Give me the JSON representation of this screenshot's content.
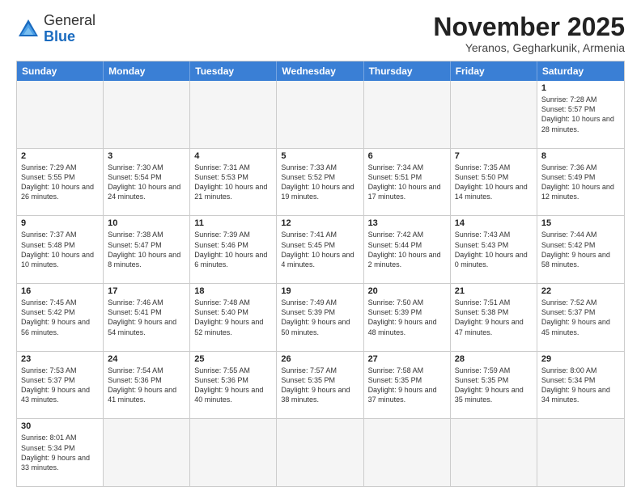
{
  "header": {
    "logo_general": "General",
    "logo_blue": "Blue",
    "month_title": "November 2025",
    "location": "Yeranos, Gegharkunik, Armenia"
  },
  "days_of_week": [
    "Sunday",
    "Monday",
    "Tuesday",
    "Wednesday",
    "Thursday",
    "Friday",
    "Saturday"
  ],
  "weeks": [
    [
      {
        "day": "",
        "info": "",
        "empty": true
      },
      {
        "day": "",
        "info": "",
        "empty": true
      },
      {
        "day": "",
        "info": "",
        "empty": true
      },
      {
        "day": "",
        "info": "",
        "empty": true
      },
      {
        "day": "",
        "info": "",
        "empty": true
      },
      {
        "day": "",
        "info": "",
        "empty": true
      },
      {
        "day": "1",
        "info": "Sunrise: 7:28 AM\nSunset: 5:57 PM\nDaylight: 10 hours and 28 minutes."
      }
    ],
    [
      {
        "day": "2",
        "info": "Sunrise: 7:29 AM\nSunset: 5:55 PM\nDaylight: 10 hours and 26 minutes."
      },
      {
        "day": "3",
        "info": "Sunrise: 7:30 AM\nSunset: 5:54 PM\nDaylight: 10 hours and 24 minutes."
      },
      {
        "day": "4",
        "info": "Sunrise: 7:31 AM\nSunset: 5:53 PM\nDaylight: 10 hours and 21 minutes."
      },
      {
        "day": "5",
        "info": "Sunrise: 7:33 AM\nSunset: 5:52 PM\nDaylight: 10 hours and 19 minutes."
      },
      {
        "day": "6",
        "info": "Sunrise: 7:34 AM\nSunset: 5:51 PM\nDaylight: 10 hours and 17 minutes."
      },
      {
        "day": "7",
        "info": "Sunrise: 7:35 AM\nSunset: 5:50 PM\nDaylight: 10 hours and 14 minutes."
      },
      {
        "day": "8",
        "info": "Sunrise: 7:36 AM\nSunset: 5:49 PM\nDaylight: 10 hours and 12 minutes."
      }
    ],
    [
      {
        "day": "9",
        "info": "Sunrise: 7:37 AM\nSunset: 5:48 PM\nDaylight: 10 hours and 10 minutes."
      },
      {
        "day": "10",
        "info": "Sunrise: 7:38 AM\nSunset: 5:47 PM\nDaylight: 10 hours and 8 minutes."
      },
      {
        "day": "11",
        "info": "Sunrise: 7:39 AM\nSunset: 5:46 PM\nDaylight: 10 hours and 6 minutes."
      },
      {
        "day": "12",
        "info": "Sunrise: 7:41 AM\nSunset: 5:45 PM\nDaylight: 10 hours and 4 minutes."
      },
      {
        "day": "13",
        "info": "Sunrise: 7:42 AM\nSunset: 5:44 PM\nDaylight: 10 hours and 2 minutes."
      },
      {
        "day": "14",
        "info": "Sunrise: 7:43 AM\nSunset: 5:43 PM\nDaylight: 10 hours and 0 minutes."
      },
      {
        "day": "15",
        "info": "Sunrise: 7:44 AM\nSunset: 5:42 PM\nDaylight: 9 hours and 58 minutes."
      }
    ],
    [
      {
        "day": "16",
        "info": "Sunrise: 7:45 AM\nSunset: 5:42 PM\nDaylight: 9 hours and 56 minutes."
      },
      {
        "day": "17",
        "info": "Sunrise: 7:46 AM\nSunset: 5:41 PM\nDaylight: 9 hours and 54 minutes."
      },
      {
        "day": "18",
        "info": "Sunrise: 7:48 AM\nSunset: 5:40 PM\nDaylight: 9 hours and 52 minutes."
      },
      {
        "day": "19",
        "info": "Sunrise: 7:49 AM\nSunset: 5:39 PM\nDaylight: 9 hours and 50 minutes."
      },
      {
        "day": "20",
        "info": "Sunrise: 7:50 AM\nSunset: 5:39 PM\nDaylight: 9 hours and 48 minutes."
      },
      {
        "day": "21",
        "info": "Sunrise: 7:51 AM\nSunset: 5:38 PM\nDaylight: 9 hours and 47 minutes."
      },
      {
        "day": "22",
        "info": "Sunrise: 7:52 AM\nSunset: 5:37 PM\nDaylight: 9 hours and 45 minutes."
      }
    ],
    [
      {
        "day": "23",
        "info": "Sunrise: 7:53 AM\nSunset: 5:37 PM\nDaylight: 9 hours and 43 minutes."
      },
      {
        "day": "24",
        "info": "Sunrise: 7:54 AM\nSunset: 5:36 PM\nDaylight: 9 hours and 41 minutes."
      },
      {
        "day": "25",
        "info": "Sunrise: 7:55 AM\nSunset: 5:36 PM\nDaylight: 9 hours and 40 minutes."
      },
      {
        "day": "26",
        "info": "Sunrise: 7:57 AM\nSunset: 5:35 PM\nDaylight: 9 hours and 38 minutes."
      },
      {
        "day": "27",
        "info": "Sunrise: 7:58 AM\nSunset: 5:35 PM\nDaylight: 9 hours and 37 minutes."
      },
      {
        "day": "28",
        "info": "Sunrise: 7:59 AM\nSunset: 5:35 PM\nDaylight: 9 hours and 35 minutes."
      },
      {
        "day": "29",
        "info": "Sunrise: 8:00 AM\nSunset: 5:34 PM\nDaylight: 9 hours and 34 minutes."
      }
    ],
    [
      {
        "day": "30",
        "info": "Sunrise: 8:01 AM\nSunset: 5:34 PM\nDaylight: 9 hours and 33 minutes."
      },
      {
        "day": "",
        "info": "",
        "empty": true
      },
      {
        "day": "",
        "info": "",
        "empty": true
      },
      {
        "day": "",
        "info": "",
        "empty": true
      },
      {
        "day": "",
        "info": "",
        "empty": true
      },
      {
        "day": "",
        "info": "",
        "empty": true
      },
      {
        "day": "",
        "info": "",
        "empty": true
      }
    ]
  ]
}
